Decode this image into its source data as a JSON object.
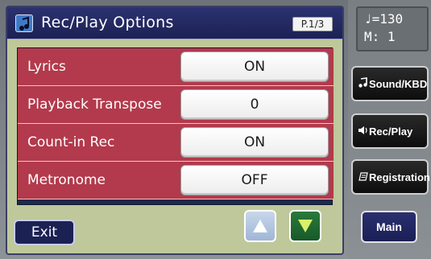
{
  "title_bar": {
    "icon": "music-note-icon",
    "title": "Rec/Play Options",
    "page": "P.1/3"
  },
  "options": [
    {
      "label": "Lyrics",
      "value": "ON"
    },
    {
      "label": "Playback Transpose",
      "value": "0"
    },
    {
      "label": "Count-in Rec",
      "value": "ON"
    },
    {
      "label": "Metronome",
      "value": "OFF"
    }
  ],
  "footer": {
    "exit_label": "Exit",
    "up_icon": "triangle-up-icon",
    "down_icon": "triangle-down-icon"
  },
  "status_display": {
    "tempo": "♩=130",
    "measure": "M:  1"
  },
  "sidebar": {
    "buttons": [
      {
        "label": "Sound/KBD",
        "icon": "music-note-icon"
      },
      {
        "label": "Rec/Play",
        "icon": "speaker-icon"
      },
      {
        "label": "Registration",
        "icon": "registration-icon"
      }
    ],
    "main_label": "Main"
  },
  "colors": {
    "screen_bg": "#bfc89a",
    "title_bar": "#1c2154",
    "option_label": "#b23a4c",
    "accent_green": "#17592a"
  }
}
